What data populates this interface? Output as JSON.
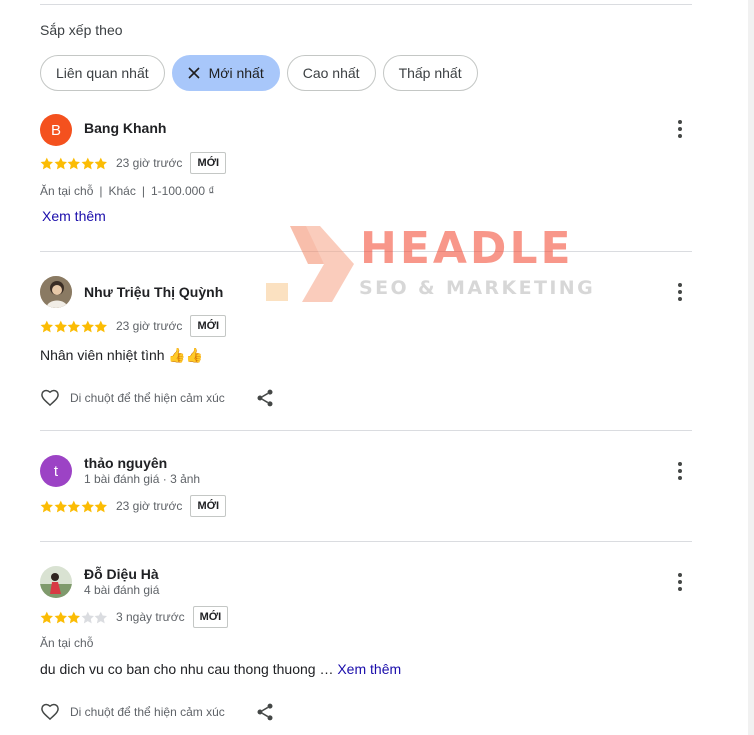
{
  "sort": {
    "label": "Sắp xếp theo",
    "options": [
      {
        "label": "Liên quan nhất",
        "active": false
      },
      {
        "label": "Mới nhất",
        "active": true
      },
      {
        "label": "Cao nhất",
        "active": false
      },
      {
        "label": "Thấp nhất",
        "active": false
      }
    ]
  },
  "reviews": [
    {
      "author": "Bang Khanh",
      "avatar_letter": "B",
      "avatar_color": "#f4511e",
      "rating": 5,
      "time": "23 giờ trước",
      "badge": "MỚI",
      "attributes": [
        "Ăn tại chỗ",
        "Khác",
        "1-100.000 ₫"
      ],
      "more_link": "Xem thêm"
    },
    {
      "author": "Như Triệu Thị Quỳnh",
      "avatar": "photo-avatar",
      "rating": 5,
      "time": "23 giờ trước",
      "badge": "MỚI",
      "text": "Nhân viên nhiệt tình 👍👍",
      "reaction_hint": "Di chuột để thể hiện cảm xúc"
    },
    {
      "author": "thảo nguyên",
      "avatar_letter": "t",
      "avatar_color": "#9c43c5",
      "meta": "1 bài đánh giá · 3 ảnh",
      "rating": 5,
      "time": "23 giờ trước",
      "badge": "MỚI"
    },
    {
      "author": "Đỗ Diệu Hà",
      "avatar": "photo-avatar",
      "meta": "4 bài đánh giá",
      "rating": 3,
      "time": "3 ngày trước",
      "badge": "MỚI",
      "attributes": [
        "Ăn tại chỗ"
      ],
      "text": "du dich vu co ban cho nhu cau thong thuong …",
      "more_link": "Xem thêm",
      "reaction_hint": "Di chuột để thể hiện cảm xúc"
    }
  ],
  "watermark": {
    "title": "HEADLE",
    "subtitle": "SEO & MARKETING"
  },
  "colors": {
    "star_filled": "#fbbc04",
    "star_empty": "#dadce0",
    "chip_active": "#a8c7fa",
    "link": "#1a0dab"
  },
  "icons": [
    "close-icon",
    "more-vert-icon",
    "star-icon",
    "heart-icon",
    "share-icon"
  ]
}
